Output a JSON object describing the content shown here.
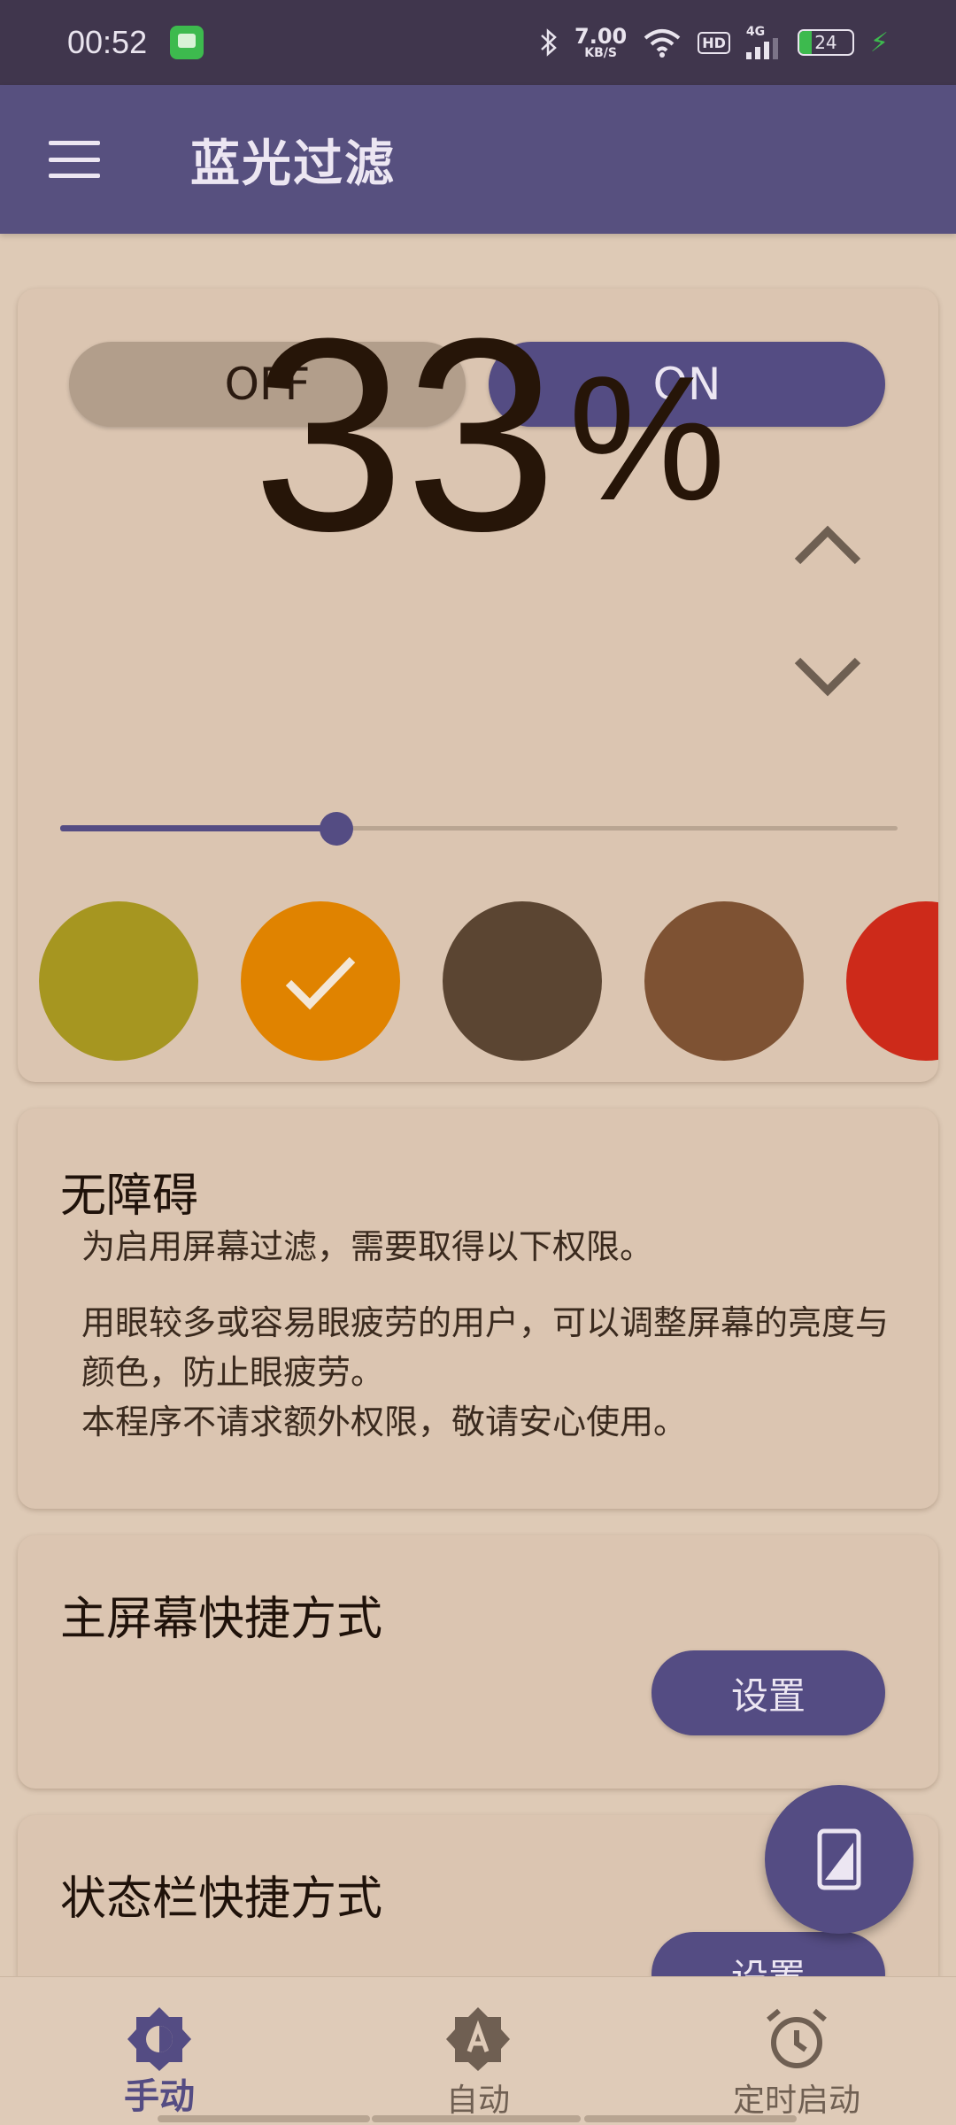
{
  "status_bar": {
    "time": "00:52",
    "net_speed": "7.00",
    "net_unit": "KB/S",
    "hd": "HD",
    "network": "4G",
    "battery": "24",
    "battery_level": 0.24
  },
  "app_bar": {
    "title": "蓝光过滤"
  },
  "filter": {
    "off_label": "OFF",
    "on_label": "ON",
    "percent": "33",
    "percent_sign": "%",
    "slider_value": 0.33,
    "swatches": [
      {
        "color": "#a69620",
        "selected": false
      },
      {
        "color": "#e08300",
        "selected": true
      },
      {
        "color": "#5b4532",
        "selected": false
      },
      {
        "color": "#7e5233",
        "selected": false
      },
      {
        "color": "#cd2a1a",
        "selected": false
      }
    ]
  },
  "accessibility": {
    "title": "无障碍",
    "text1": "为启用屏幕过滤，需要取得以下权限。",
    "text2": "用眼较多或容易眼疲劳的用户，可以调整屏幕的亮度与颜色，防止眼疲劳。",
    "text3": "本程序不请求额外权限，敬请安心使用。"
  },
  "home_shortcut": {
    "title": "主屏幕快捷方式",
    "button": "设置"
  },
  "status_shortcut": {
    "title": "状态栏快捷方式",
    "button": "设置"
  },
  "bottom_nav": {
    "items": [
      {
        "label": "手动",
        "icon": "brightness-icon",
        "active": true
      },
      {
        "label": "自动",
        "icon": "auto-brightness-icon",
        "active": false
      },
      {
        "label": "定时启动",
        "icon": "alarm-clock-icon",
        "active": false
      }
    ]
  },
  "colors": {
    "primary": "#544c83",
    "background": "#decab6",
    "card": "#dbc5b1"
  }
}
